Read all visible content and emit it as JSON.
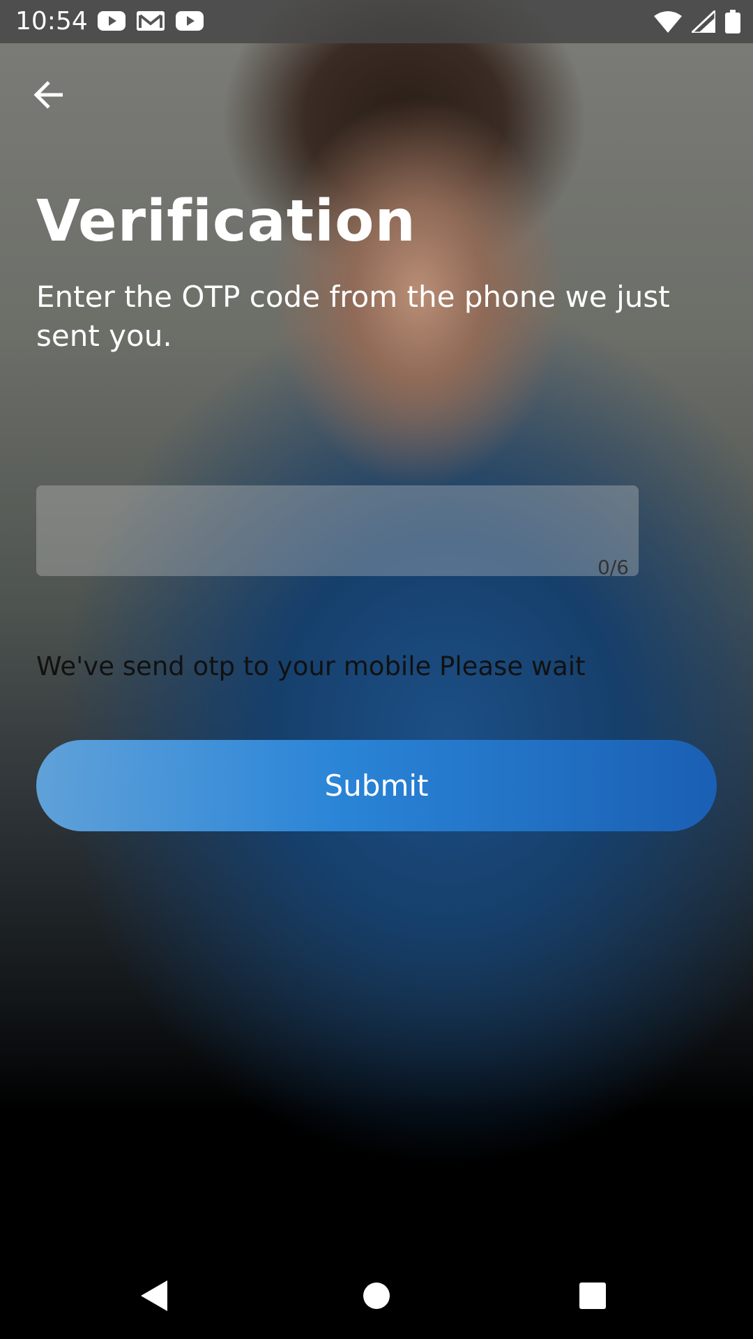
{
  "status_bar": {
    "time": "10:54",
    "notification_icons": [
      "youtube-icon",
      "gmail-icon",
      "youtube-icon"
    ],
    "system_icons": [
      "wifi-icon",
      "signal-icon",
      "battery-icon"
    ]
  },
  "header": {
    "back_icon": "arrow-left-icon"
  },
  "main": {
    "title": "Verification",
    "subtitle": "Enter the OTP code from the phone we just sent you.",
    "otp": {
      "value": "",
      "placeholder": "",
      "counter": "0/6"
    },
    "hint": "We've send otp to your mobile Please wait",
    "submit_label": "Submit"
  },
  "colors": {
    "accent": "#2a84d6",
    "accent_dark": "#1a5fb3",
    "text_light": "#ffffff"
  },
  "nav_bar": {
    "icons": [
      "back-triangle-icon",
      "home-circle-icon",
      "recents-square-icon"
    ]
  }
}
